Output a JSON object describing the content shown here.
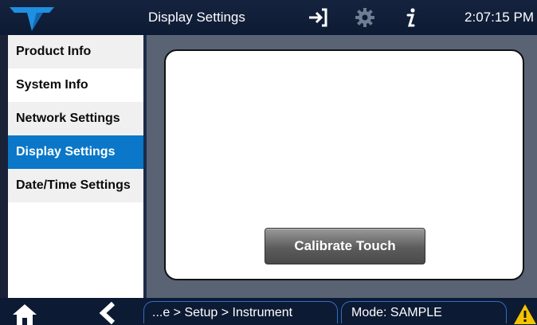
{
  "header": {
    "title": "Display Settings",
    "time": "2:07:15 PM",
    "icons": [
      "login-arrow-icon",
      "gear-icon",
      "info-icon"
    ]
  },
  "sidebar": {
    "items": [
      {
        "label": "Product Info",
        "active": false
      },
      {
        "label": "System Info",
        "active": false
      },
      {
        "label": "Network Settings",
        "active": false
      },
      {
        "label": "Display Settings",
        "active": true
      },
      {
        "label": "Date/Time Settings",
        "active": false
      }
    ]
  },
  "main": {
    "calibrate_button": "Calibrate Touch"
  },
  "footer": {
    "breadcrumb": "...e > Setup > Instrument",
    "mode": "Mode: SAMPLE",
    "icons": [
      "home-icon",
      "back-arrow-icon",
      "warning-icon"
    ]
  },
  "colors": {
    "header_bg": "#0d1a33",
    "active_item": "#0a77c8",
    "main_bg": "#5a6374",
    "warning": "#f4c400"
  }
}
